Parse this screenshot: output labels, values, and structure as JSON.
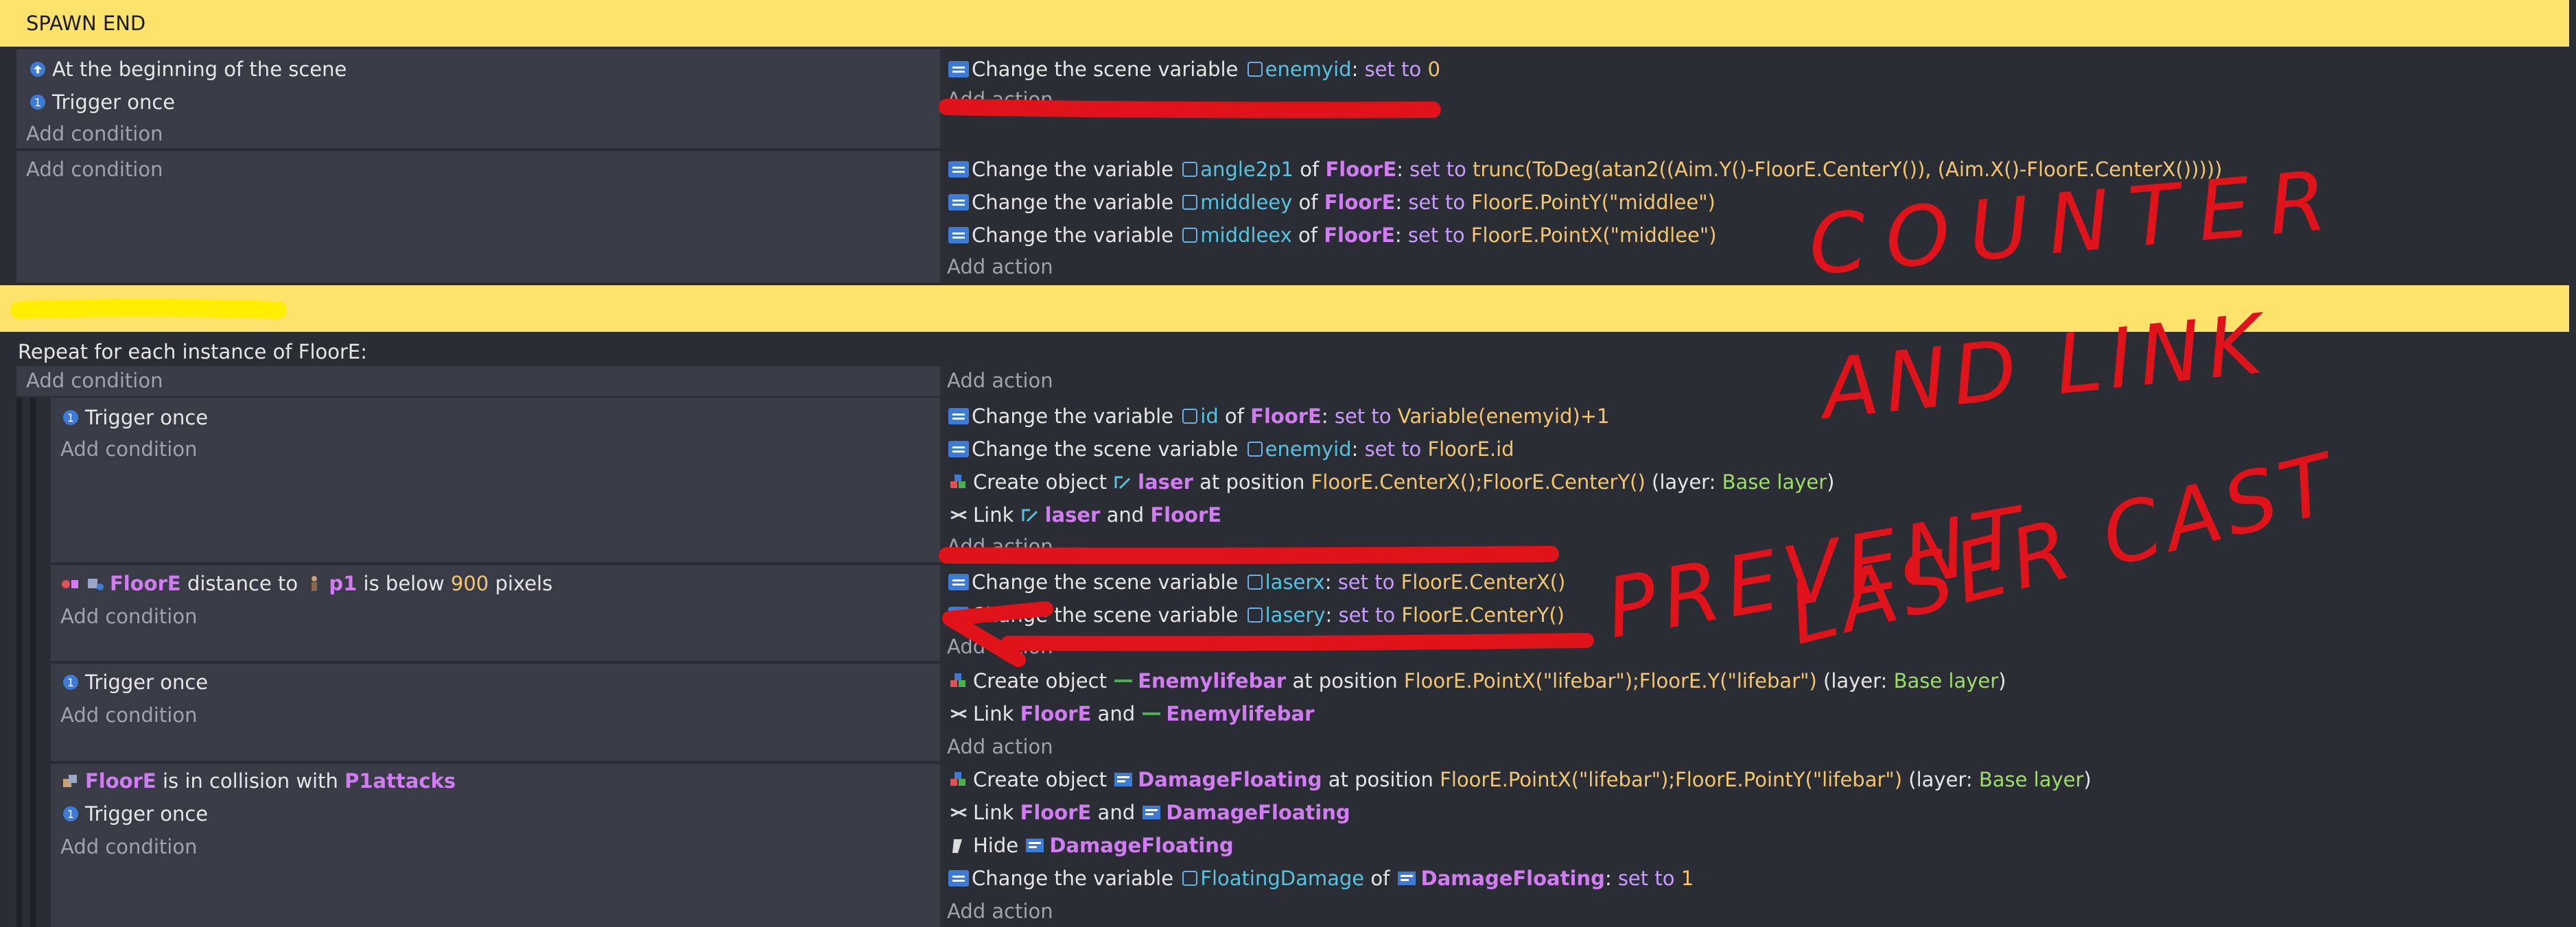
{
  "events": {
    "comment1": "SPAWN END",
    "e1": {
      "conditions": [
        "At the beginning of the scene",
        "Trigger once"
      ],
      "add_condition": "Add condition",
      "action1": {
        "text": "Change the scene variable",
        "var": "enemyid",
        "sep": ":",
        "op": "set to",
        "value": "0"
      },
      "add_action": "Add action"
    },
    "e2": {
      "add_condition": "Add condition",
      "actions": [
        {
          "text": "Change the variable",
          "var": "angle2p1",
          "of": "of",
          "obj": "FloorE",
          "sep": ":",
          "op": "set to",
          "value": "trunc(ToDeg(atan2((Aim.Y()-FloorE.CenterY()), (Aim.X()-FloorE.CenterX()))))"
        },
        {
          "text": "Change the variable",
          "var": "middleey",
          "of": "of",
          "obj": "FloorE",
          "sep": ":",
          "op": "set to",
          "value": "FloorE.PointY(\"middlee\")"
        },
        {
          "text": "Change the variable",
          "var": "middleex",
          "of": "of",
          "obj": "FloorE",
          "sep": ":",
          "op": "set to",
          "value": "FloorE.PointX(\"middlee\")"
        }
      ],
      "add_action": "Add action"
    },
    "comment2": "",
    "repeat": {
      "label": "Repeat for each instance of FloorE:",
      "add_condition": "Add condition",
      "add_action": "Add action"
    },
    "s1": {
      "condition": "Trigger once",
      "add_condition": "Add condition",
      "a1": {
        "text": "Change the variable",
        "var": "id",
        "of": "of",
        "obj": "FloorE",
        "sep": ":",
        "op": "set to",
        "value": "Variable(enemyid)+1"
      },
      "a2": {
        "text": "Change the scene variable",
        "var": "enemyid",
        "sep": ":",
        "op": "set to",
        "value": "FloorE.id"
      },
      "a3": {
        "text": "Create object",
        "obj": "laser",
        "at": "at position",
        "value": "FloorE.CenterX();FloorE.CenterY()",
        "layer_open": "(layer:",
        "layer": "Base layer",
        "layer_close": ")"
      },
      "a4": {
        "text": "Link",
        "obj1": "laser",
        "and": "and",
        "obj2": "FloorE"
      },
      "add_action": "Add action"
    },
    "s2": {
      "obj": "FloorE",
      "c1": "distance to",
      "obj2": "p1",
      "c2": "is below",
      "num": "900",
      "c3": "pixels",
      "add_condition": "Add condition",
      "a1": {
        "text": "Change the scene variable",
        "var": "laserx",
        "sep": ":",
        "op": "set to",
        "value": "FloorE.CenterX()"
      },
      "a2": {
        "text": "Change the scene variable",
        "var": "lasery",
        "sep": ":",
        "op": "set to",
        "value": "FloorE.CenterY()"
      },
      "add_action": "Add action"
    },
    "s3": {
      "condition": "Trigger once",
      "add_condition": "Add condition",
      "a1": {
        "text": "Create object",
        "obj": "Enemylifebar",
        "at": "at position",
        "value": "FloorE.PointX(\"lifebar\");FloorE.Y(\"lifebar\")",
        "layer_open": "(layer:",
        "layer": "Base layer",
        "layer_close": ")"
      },
      "a2": {
        "text": "Link",
        "obj1": "FloorE",
        "and": "and",
        "obj2": "Enemylifebar"
      },
      "add_action": "Add action"
    },
    "s4": {
      "obj": "FloorE",
      "c1": "is in collision with",
      "obj2": "P1attacks",
      "c2": "Trigger once",
      "add_condition": "Add condition",
      "a1": {
        "text": "Create object",
        "obj": "DamageFloating",
        "at": "at position",
        "value": "FloorE.PointX(\"lifebar\");FloorE.PointY(\"lifebar\")",
        "layer_open": "(layer:",
        "layer": "Base layer",
        "layer_close": ")"
      },
      "a2": {
        "text": "Link",
        "obj1": "FloorE",
        "and": "and",
        "obj2": "DamageFloating"
      },
      "a3": {
        "text": "Hide",
        "obj": "DamageFloating"
      },
      "a4": {
        "text": "Change the variable",
        "var": "FloatingDamage",
        "of": "of",
        "obj": "DamageFloating",
        "sep": ":",
        "op": "set to",
        "value": "1"
      },
      "add_action": "Add action"
    }
  },
  "annotations": {
    "counter": "COUNTER",
    "and_link": "AND LINK",
    "prevent": "PREVENT",
    "laser_cast": "LASER CAST",
    "ink_red": "#e0131a",
    "highlight_yellow": "#ffee00"
  },
  "colors": {
    "background": "#2b2d35",
    "condition_panel": "#393c47",
    "comment_bar": "#fde26c",
    "object_name": "#d27cf4",
    "variable_name": "#56c3e0",
    "operator": "#c89cff",
    "value": "#f2c66d",
    "layer": "#9fdc6a"
  }
}
